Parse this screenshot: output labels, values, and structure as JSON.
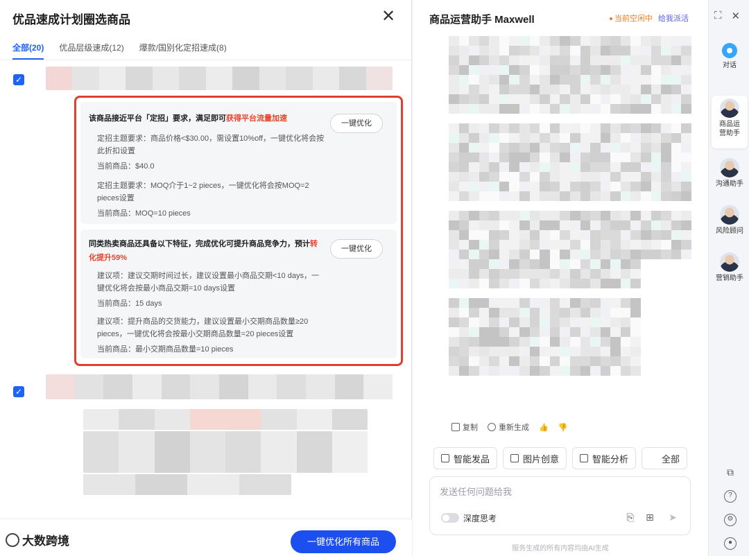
{
  "left": {
    "title": "优品速成计划圈选商品",
    "tabs": [
      {
        "label": "全部(20)"
      },
      {
        "label": "优品层级速成(12)"
      },
      {
        "label": "爆款/国别化定招速成(8)"
      }
    ],
    "card1": {
      "head_prefix": "该商品接近平台「定招」要求，满足即可",
      "head_highlight": "获得平台流量加速",
      "button": "一键优化",
      "item1_req": "定招主题要求：商品价格<$30.00，需设置10%off，一键优化将会按此折扣设置",
      "item1_cur": "当前商品：$40.0",
      "item2_req": "定招主题要求：MOQ介于1~2 pieces，一键优化将会按MOQ=2 pieces设置",
      "item2_cur": "当前商品：MOQ=10 pieces"
    },
    "card2": {
      "head_prefix": "同类热卖商品还具备以下特征，完成优化可提升商品竞争力，预计",
      "head_highlight": "转化提升59%",
      "button": "一键优化",
      "item1_req": "建议项：建议交期时间过长，建议设置最小商品交期<10 days，一键优化将会按最小商品交期=10 days设置",
      "item1_cur": "当前商品：15 days",
      "item2_req": "建议项：提升商品的交货能力，建议设置最小交期商品数量≥20 pieces，一键优化将会按最小交期商品数量=20 pieces设置",
      "item2_cur": "当前商品：最小交期商品数量=10 pieces"
    },
    "optimize_all": "一键优化所有商品",
    "watermark": "大数跨境"
  },
  "mid": {
    "title": "商品运营助手 Maxwell",
    "status": "当前空闲中",
    "dispatch": "给我派活",
    "actions": {
      "copy": "复制",
      "regen": "重新生成"
    },
    "quick": [
      {
        "label": "智能发品"
      },
      {
        "label": "图片创意"
      },
      {
        "label": "智能分析"
      },
      {
        "label": "全部"
      }
    ],
    "input_placeholder": "发送任何问题给我",
    "deep_think": "深度思考",
    "disclaimer": "服务生成的所有内容均由AI生成"
  },
  "rail": {
    "items": [
      {
        "label": "对话"
      },
      {
        "label": "商品运营助手"
      },
      {
        "label": "沟通助手"
      },
      {
        "label": "风险顾问"
      },
      {
        "label": "营销助手"
      }
    ]
  },
  "colors": {
    "accent": "#1d63f5",
    "highlight": "#e8442c",
    "status": "#f07b1c"
  }
}
